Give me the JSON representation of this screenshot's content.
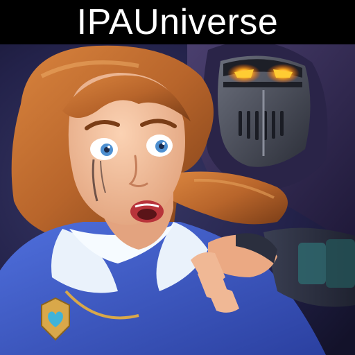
{
  "banner": {
    "text": "IPAUniverse"
  },
  "artwork": {
    "subject": "game-icon-art",
    "elements": [
      "frightened-woman",
      "hooded-armored-knight",
      "gloved-hand-on-shoulder",
      "gold-heart-pendant"
    ]
  },
  "colors": {
    "banner_background": "#000000",
    "banner_text": "#ffffff",
    "background_dark": "#1c1b3a",
    "sweater_blue": "#3b59c9",
    "hair_auburn": "#b8652b",
    "skin": "#f0b895",
    "knight_glow": "#ff9a1a",
    "pendant_gold": "#d9a84a",
    "pendant_gem": "#3fb3d9"
  }
}
